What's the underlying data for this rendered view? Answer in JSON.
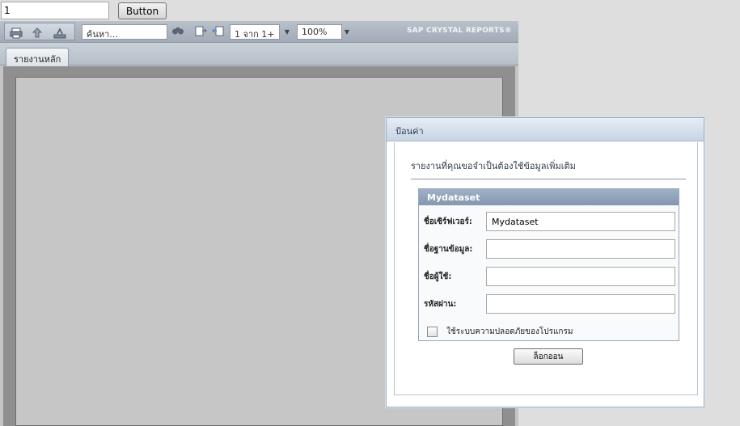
{
  "top": {
    "input_value": "1",
    "button_label": "Button"
  },
  "toolbar": {
    "icons": [
      "print-icon",
      "export-icon",
      "toggle-tree-icon",
      "find-icon",
      "first-page-icon",
      "previous-page-icon"
    ],
    "search_placeholder": "ค้นหา...",
    "page_indicator": "1 จาก 1+",
    "zoom_value": "100%",
    "brand": "SAP CRYSTAL REPORTS®"
  },
  "tabs": [
    {
      "label": "รายงานหลัก"
    }
  ],
  "dialog": {
    "title": "ป้อนค่า",
    "prompt": "รายงานที่คุณขอจำเป็นต้องใช้ข้อมูลเพิ่มเติม",
    "group": {
      "title": "Mydataset",
      "fields": [
        {
          "label": "ชื่อเซิร์ฟเวอร์:",
          "value": "Mydataset"
        },
        {
          "label": "ชื่อฐานข้อมูล:",
          "value": ""
        },
        {
          "label": "ชื่อผู้ใช้:",
          "value": ""
        },
        {
          "label": "รหัสผ่าน:",
          "value": ""
        }
      ],
      "checkbox_label": "ใช้ระบบความปลอดภัยของโปรแกรม"
    },
    "login_label": "ล็อกออน"
  }
}
